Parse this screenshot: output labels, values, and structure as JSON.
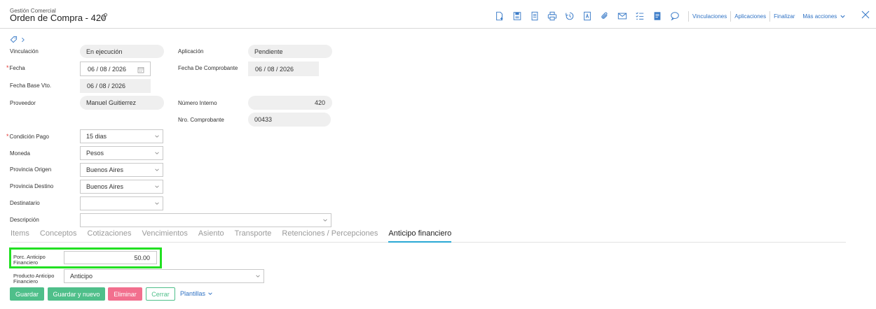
{
  "header": {
    "subtitle": "Gestión Comercial",
    "title": "Orden de Compra - 420",
    "toolbar_icons": [
      "new-doc-icon",
      "save-icon",
      "copy-doc-icon",
      "print-icon",
      "history-icon",
      "pdf-icon",
      "attach-icon",
      "email-icon",
      "checklist-icon",
      "notes-icon",
      "comment-icon"
    ],
    "links": {
      "vinculaciones": "Vinculaciones",
      "aplicaciones": "Aplicaciones",
      "finalizar": "Finalizar",
      "mas_acciones": "Más acciones"
    }
  },
  "form": {
    "vinculacion": {
      "label": "Vinculación",
      "value": "En ejecución"
    },
    "aplicacion": {
      "label": "Aplicación",
      "value": "Pendiente"
    },
    "fecha": {
      "label": "Fecha",
      "value": "06 / 08 / 2026",
      "required": "*"
    },
    "fecha_comprobante": {
      "label": "Fecha De Comprobante",
      "value": "06 / 08 / 2026"
    },
    "fecha_base_vto": {
      "label": "Fecha Base Vto.",
      "value": "06 / 08 / 2026"
    },
    "proveedor": {
      "label": "Proveedor",
      "value": "Manuel Guitierrez"
    },
    "numero_interno": {
      "label": "Número Interno",
      "value": "420"
    },
    "nro_comprobante": {
      "label": "Nro. Comprobante",
      "value": "00433"
    },
    "condicion_pago": {
      "label": "Condición Pago",
      "value": "15 dias",
      "required": "*"
    },
    "moneda": {
      "label": "Moneda",
      "value": "Pesos"
    },
    "provincia_origen": {
      "label": "Provincia Origen",
      "value": "Buenos Aires"
    },
    "provincia_destino": {
      "label": "Provincia Destino",
      "value": "Buenos Aires"
    },
    "destinatario": {
      "label": "Destinatario",
      "value": ""
    },
    "descripcion": {
      "label": "Descripción",
      "value": ""
    }
  },
  "tabs": [
    "Items",
    "Conceptos",
    "Cotizaciones",
    "Vencimientos",
    "Asiento",
    "Transporte",
    "Retenciones / Percepciones",
    "Anticipo financiero"
  ],
  "active_tab": "Anticipo financiero",
  "anticipo": {
    "porc_label_1": "Porc. Anticipo",
    "porc_label_2": "Financiero",
    "porc_value": "50.00",
    "producto_label_1": "Producto Anticipo",
    "producto_label_2": "Financiero",
    "producto_value": "Anticipo"
  },
  "buttons": {
    "guardar": "Guardar",
    "guardar_y_nuevo": "Guardar y nuevo",
    "eliminar": "Eliminar",
    "cerrar": "Cerrar",
    "plantillas": "Plantillas"
  },
  "colors": {
    "accent": "#2f72c4",
    "green": "#4fbf8a",
    "red": "#f26f8e",
    "highlight": "#22e022",
    "tab_underline": "#2aa8d4"
  }
}
